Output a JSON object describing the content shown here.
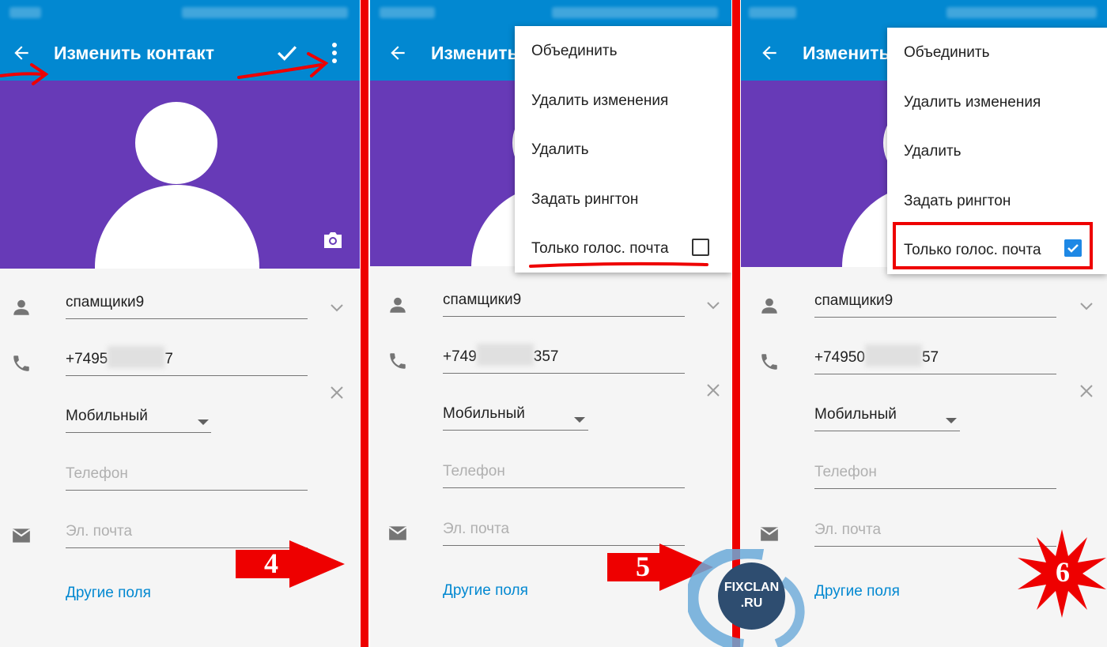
{
  "screen": {
    "title": "Изменить контакт",
    "contact_name": "спамщики9",
    "phone_type": "Мобильный",
    "phone_placeholder": "Телефон",
    "email_placeholder": "Эл. почта",
    "more_fields": "Другие поля"
  },
  "panels": [
    {
      "step": "4",
      "phone_prefix": "+7495",
      "phone_suffix": "7"
    },
    {
      "step": "5",
      "phone_prefix": "+749",
      "phone_suffix": "357"
    },
    {
      "step": "6",
      "phone_prefix": "+74950",
      "phone_suffix": "57"
    }
  ],
  "menu": {
    "items": [
      "Объединить",
      "Удалить изменения",
      "Удалить",
      "Задать рингтон"
    ],
    "voicemail_label": "Только голос. почта",
    "voicemail_checked_panel2": false,
    "voicemail_checked_panel3": true
  },
  "watermark": {
    "line1": "FIXCLAN",
    "line2": ".RU"
  },
  "colors": {
    "app_bar": "#0288d1",
    "header": "#673ab7",
    "accent_link": "#0288d1",
    "annotation_red": "#ee0000",
    "checkbox_checked": "#1e88e5"
  },
  "icons": [
    "back-arrow-icon",
    "check-icon",
    "more-vert-icon",
    "camera-icon",
    "person-icon",
    "phone-icon",
    "email-icon",
    "chevron-down-icon",
    "close-icon",
    "dropdown-arrow-icon"
  ]
}
